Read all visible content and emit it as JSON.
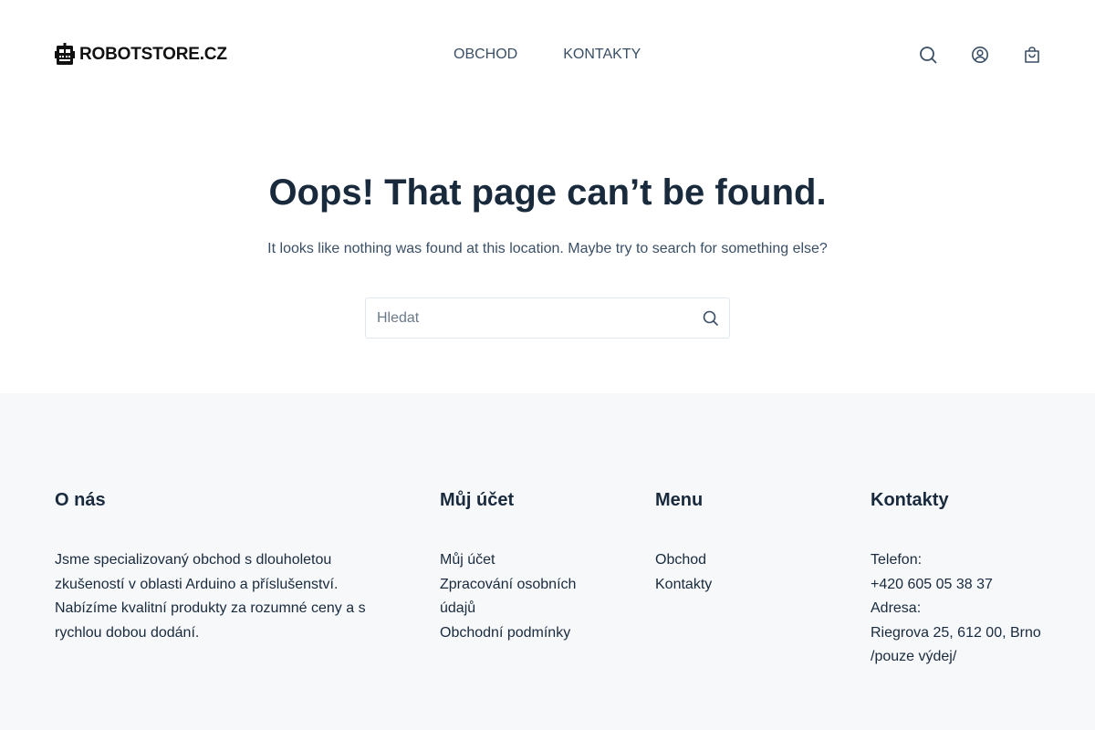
{
  "header": {
    "logo_text": "ROBOTSTORE.CZ",
    "nav": [
      {
        "label": "OBCHOD"
      },
      {
        "label": "KONTAKTY"
      }
    ],
    "icons": [
      "search-icon",
      "account-icon",
      "cart-icon"
    ]
  },
  "main": {
    "title": "Oops! That page can’t be found.",
    "subtitle": "It looks like nothing was found at this location. Maybe try to search for something else?",
    "search": {
      "placeholder": "Hledat",
      "value": ""
    }
  },
  "footer": {
    "about": {
      "heading": "O nás",
      "text": "Jsme specializovaný obchod s dlouholetou zkušeností v oblasti Arduino a příslušenství. Nabízíme kvalitní produkty za rozumné ceny a s rychlou dobou dodání."
    },
    "account": {
      "heading": "Můj účet",
      "links": [
        {
          "label": "Můj účet"
        },
        {
          "label": "Zpracování osobních údajů"
        },
        {
          "label": "Obchodní podmínky"
        }
      ]
    },
    "menu": {
      "heading": "Menu",
      "links": [
        {
          "label": "Obchod"
        },
        {
          "label": "Kontakty"
        }
      ]
    },
    "contacts": {
      "heading": "Kontakty",
      "phone_label": "Telefon:",
      "phone": "+420 605 05 38 37",
      "address_label": "Adresa:",
      "address": "Riegrova 25, 612 00, Brno",
      "note": "/pouze výdej/"
    }
  },
  "colors": {
    "heading": "#192a3d",
    "text": "#3a4f66",
    "footer_bg": "#f6f8fa",
    "border": "#e1e8ed"
  }
}
